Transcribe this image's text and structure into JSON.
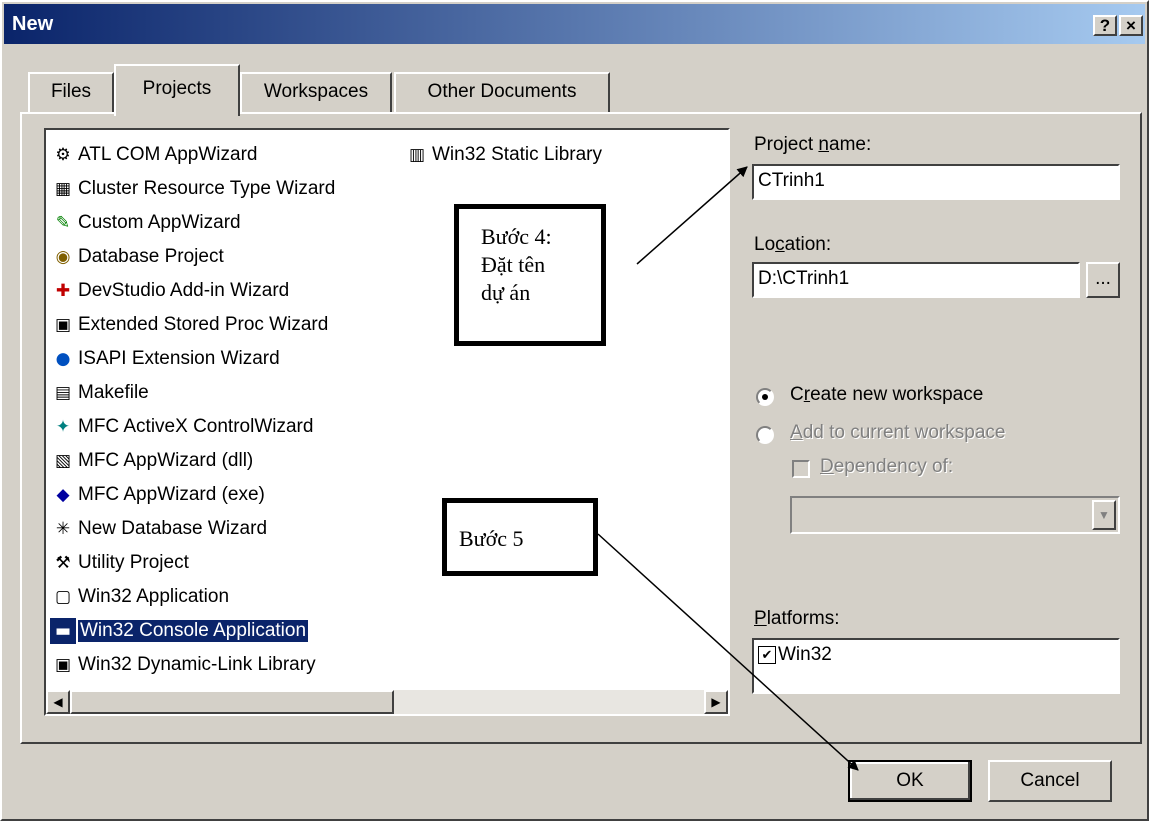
{
  "window": {
    "title": "New",
    "help_label": "?",
    "close_label": "×"
  },
  "tabs": [
    {
      "label": "Files"
    },
    {
      "label": "Projects"
    },
    {
      "label": "Workspaces"
    },
    {
      "label": "Other Documents"
    }
  ],
  "projects": [
    {
      "label": "ATL COM AppWizard",
      "icon": "atl-icon"
    },
    {
      "label": "Cluster Resource Type Wizard",
      "icon": "cluster-icon"
    },
    {
      "label": "Custom AppWizard",
      "icon": "custom-wizard-icon"
    },
    {
      "label": "Database Project",
      "icon": "database-icon"
    },
    {
      "label": "DevStudio Add-in Wizard",
      "icon": "addin-icon"
    },
    {
      "label": "Extended Stored Proc Wizard",
      "icon": "stored-proc-icon"
    },
    {
      "label": "ISAPI Extension Wizard",
      "icon": "globe-icon"
    },
    {
      "label": "Makefile",
      "icon": "makefile-icon"
    },
    {
      "label": "MFC ActiveX ControlWizard",
      "icon": "activex-icon"
    },
    {
      "label": "MFC AppWizard (dll)",
      "icon": "mfc-dll-icon"
    },
    {
      "label": "MFC AppWizard (exe)",
      "icon": "mfc-exe-icon"
    },
    {
      "label": "New Database Wizard",
      "icon": "database-wizard-icon"
    },
    {
      "label": "Utility Project",
      "icon": "utility-icon"
    },
    {
      "label": "Win32 Application",
      "icon": "win32-app-icon"
    },
    {
      "label": "Win32 Console Application",
      "icon": "console-icon",
      "selected": true
    },
    {
      "label": "Win32 Dynamic-Link Library",
      "icon": "dll-icon"
    },
    {
      "label": "Win32 Static Library",
      "icon": "static-lib-icon"
    }
  ],
  "project_name": {
    "label_pre": "Project ",
    "label_ul": "n",
    "label_post": "ame:",
    "value": "CTrinh1"
  },
  "location": {
    "label_pre": "Lo",
    "label_ul": "c",
    "label_post": "ation:",
    "value": "D:\\CTrinh1",
    "browse_label": "..."
  },
  "workspace": {
    "create_pre": "C",
    "create_ul": "r",
    "create_post": "eate new workspace",
    "add_ul": "A",
    "add_post": "dd to current workspace",
    "dep_ul": "D",
    "dep_post": "ependency of:"
  },
  "platforms": {
    "label_ul": "P",
    "label_post": "latforms:",
    "items": [
      {
        "label": "Win32",
        "checked": true
      }
    ]
  },
  "buttons": {
    "ok": "OK",
    "cancel": "Cancel"
  },
  "annotations": {
    "step4": [
      "Bước 4:",
      "Đặt tên",
      "dự án"
    ],
    "step5": "Bước 5"
  }
}
